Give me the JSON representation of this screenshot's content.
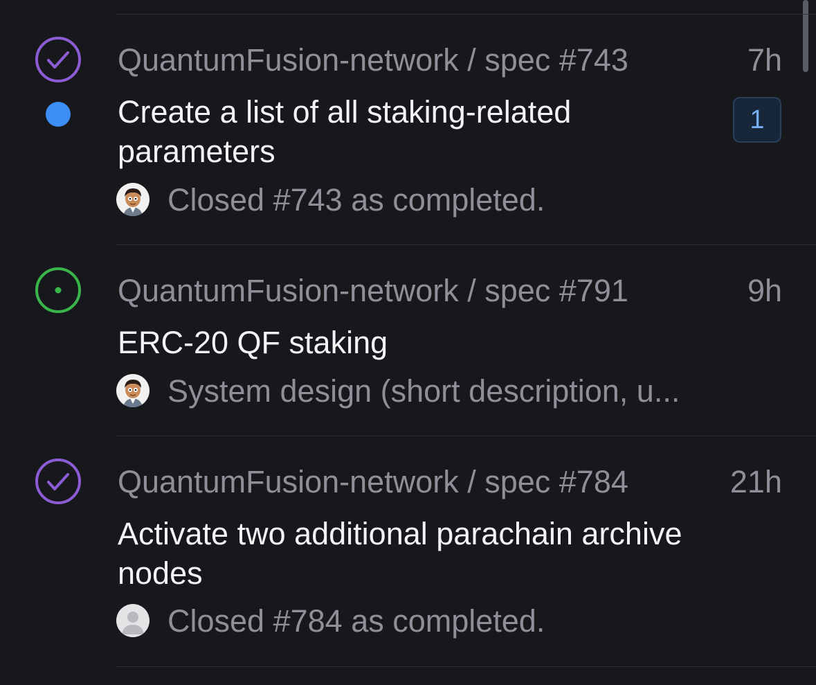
{
  "colors": {
    "background": "#17181c",
    "closed_purple": "#8c5cd4",
    "open_green": "#3ab54a",
    "unread_blue": "#3d8ef7",
    "muted_text": "#8e8f98",
    "primary_text": "#f3f3f5"
  },
  "notifications": [
    {
      "status_icon": "check-circle-icon",
      "unread": true,
      "repo": "QuantumFusion-network / spec #743",
      "time": "7h",
      "title": "Create a list of all staking-related parameters",
      "badge": "1",
      "avatar": "cartoon-avatar",
      "snippet": "Closed #743 as completed."
    },
    {
      "status_icon": "open-issue-icon",
      "unread": false,
      "repo": "QuantumFusion-network / spec #791",
      "time": "9h",
      "title": "ERC-20 QF staking",
      "avatar": "cartoon-avatar",
      "snippet": "System design (short description, u..."
    },
    {
      "status_icon": "check-circle-icon",
      "unread": false,
      "repo": "QuantumFusion-network / spec #784",
      "time": "21h",
      "title": "Activate two additional parachain archive nodes",
      "avatar": "default-avatar",
      "snippet": "Closed #784 as completed."
    }
  ]
}
